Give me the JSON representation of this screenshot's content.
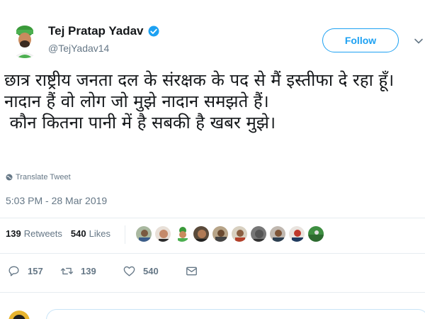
{
  "author": {
    "display_name": "Tej Pratap Yadav",
    "handle": "@TejYadav14",
    "verified": true
  },
  "follow_button": {
    "label": "Follow"
  },
  "tweet": {
    "text": "छात्र राष्ट्रीय जनता दल के संरक्षक के पद से मैं इस्तीफा दे रहा हूँ।\nनादान हैं वो लोग जो मुझे नादान समझते हैं।\n कौन कितना पानी में है सबकी है खबर मुझे।",
    "translate_label": "Translate Tweet",
    "timestamp": "5:03 PM - 28 Mar 2019"
  },
  "stats": {
    "retweets_count": "139",
    "retweets_label": "Retweets",
    "likes_count": "540",
    "likes_label": "Likes"
  },
  "actions": {
    "reply_count": "157",
    "retweet_count": "139",
    "like_count": "540"
  },
  "colors": {
    "accent": "#1da1f2",
    "muted": "#657786",
    "text": "#14171a",
    "divider": "#e6ecf0"
  },
  "icons": [
    "verified-badge-icon",
    "chevron-down-icon",
    "globe-icon",
    "reply-icon",
    "retweet-icon",
    "like-icon",
    "message-icon"
  ]
}
